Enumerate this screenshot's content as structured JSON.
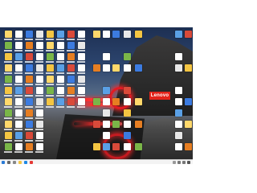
{
  "brand": {
    "logo_text": "Lenovo",
    "logo_color": "#e2231a"
  },
  "taskbar": {
    "apps": [
      "start-icon",
      "search-icon",
      "task-view-icon",
      "file-explorer-icon",
      "browser-icon",
      "app-icon"
    ],
    "tray": [
      "tray-up-arrow-icon",
      "network-icon",
      "volume-icon",
      "notification-icon"
    ]
  },
  "desktop": {
    "icon_colors": [
      "#ffd86b",
      "#ffffff",
      "#3c7be0",
      "#e8e8e8",
      "#f4c542",
      "#5aa0e6",
      "#d94a3a",
      "#ffffff",
      "#7ab648",
      "#ffffff",
      "#e67e22",
      "#ffffff"
    ]
  }
}
